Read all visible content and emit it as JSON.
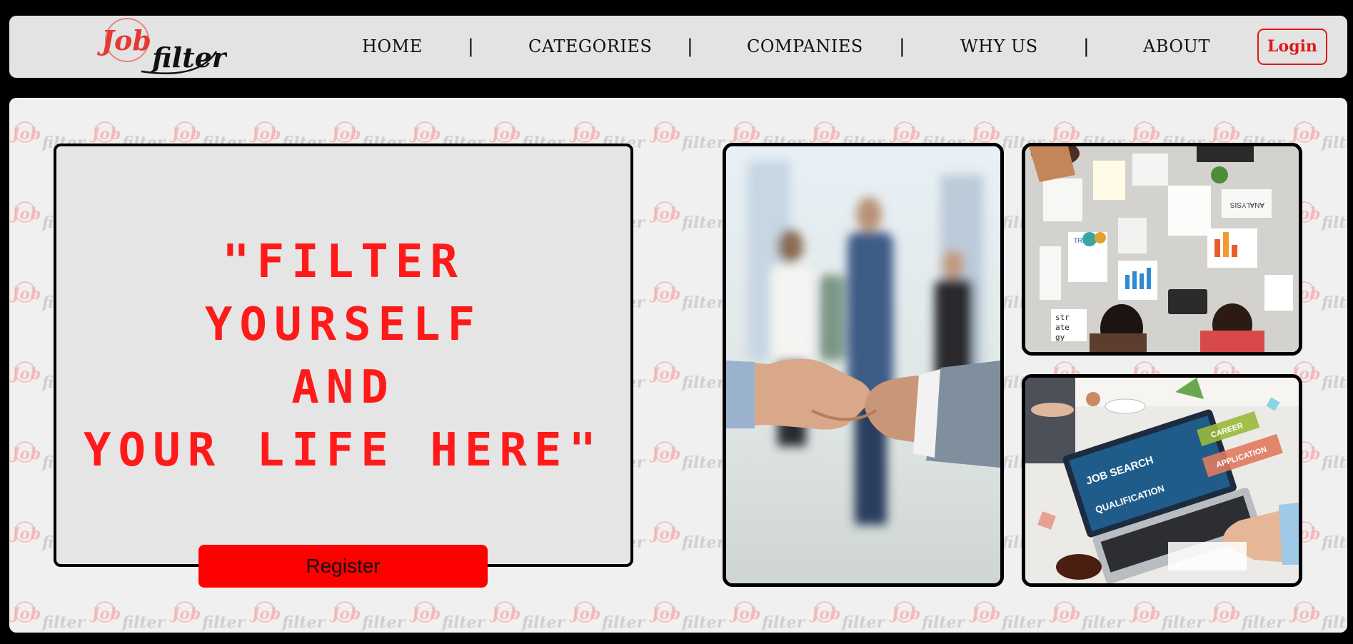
{
  "header": {
    "logo": {
      "text_red": "Job",
      "text_black": "filter"
    },
    "nav": [
      {
        "label": "HOME"
      },
      {
        "label": "CATEGORIES"
      },
      {
        "label": "COMPANIES"
      },
      {
        "label": "WHY US"
      },
      {
        "label": "ABOUT"
      }
    ],
    "separator": "|",
    "login_label": "Login"
  },
  "hero": {
    "quote_lines": [
      "\"FILTER",
      "YOURSELF",
      "AND",
      "YOUR LIFE HERE\""
    ],
    "register_label": "Register"
  },
  "photos": {
    "handshake": {
      "icon": "handshake-photo"
    },
    "meeting": {
      "icon": "team-meeting-photo",
      "text": [
        "ANALYSIS",
        "TRENDS",
        "str",
        "ate",
        "gy"
      ]
    },
    "jobsearch": {
      "icon": "job-search-laptop-photo",
      "text": [
        "JOB SEARCH",
        "QUALIFICATION",
        "CAREER",
        "APPLICATION"
      ]
    }
  },
  "colors": {
    "brand_red": "#ff0000",
    "login_red": "#e01818",
    "header_bg": "#e3e3e3",
    "panel_bg": "#f0f0f0",
    "card_bg": "#e5e5e5"
  }
}
